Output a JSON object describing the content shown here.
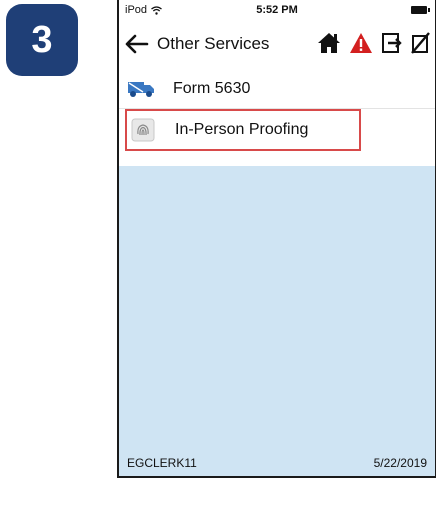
{
  "step": {
    "number": "3",
    "color": "#1f3f77"
  },
  "status_bar": {
    "device": "iPod",
    "time": "5:52 PM"
  },
  "nav": {
    "title": "Other Services",
    "icons": [
      "back-arrow-icon",
      "home-icon",
      "warning-icon",
      "logout-icon",
      "no-signature-icon"
    ]
  },
  "list": {
    "items": [
      {
        "label": "Form 5630",
        "icon": "truck-icon"
      },
      {
        "label": "In-Person Proofing",
        "icon": "fingerprint-icon",
        "highlighted": true
      }
    ]
  },
  "footer": {
    "user": "EGCLERK11",
    "date": "5/22/2019"
  },
  "colors": {
    "content_bg": "#cfe4f3",
    "highlight_border": "#d84a4a",
    "warning": "#d32020"
  }
}
